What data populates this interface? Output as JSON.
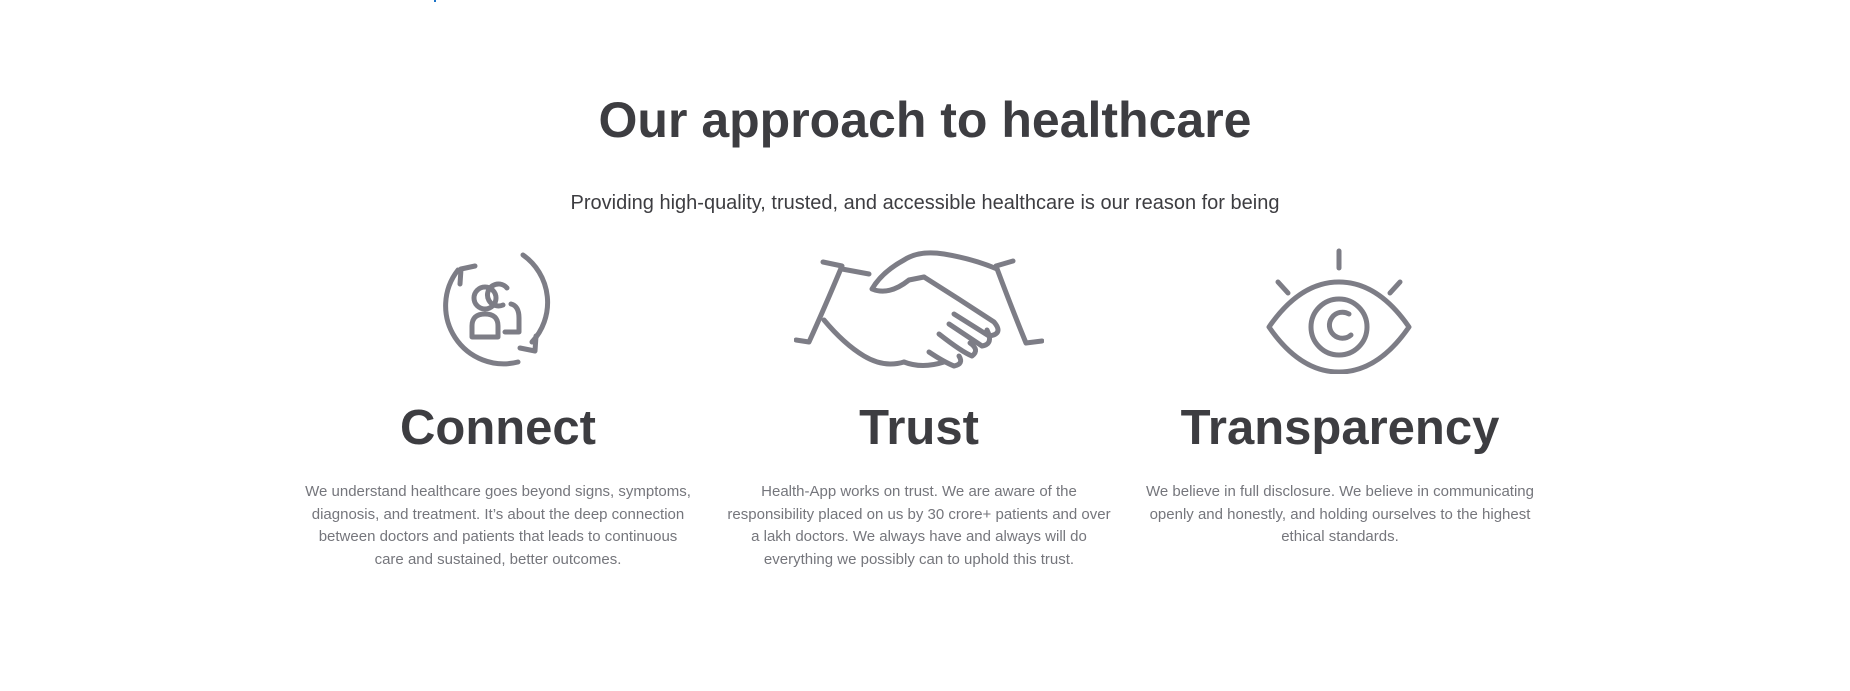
{
  "section": {
    "title": "Our approach to healthcare",
    "subtitle": "Providing high-quality, trusted, and accessible healthcare is our reason for being"
  },
  "cards": [
    {
      "icon": "connect-people-cycle-icon",
      "title": "Connect",
      "text": "We understand healthcare goes beyond signs, symptoms, diagnosis, and treatment. It’s about the deep connection between doctors and patients that leads to continuous care and sustained, better outcomes."
    },
    {
      "icon": "handshake-icon",
      "title": "Trust",
      "text": "Health-App works on trust. We are aware of the responsibility placed on us by 30 crore+ patients and over a lakh doctors. We always have and always will do everything we possibly can to uphold this trust."
    },
    {
      "icon": "eye-icon",
      "title": "Transparency",
      "text": "We believe in full disclosure. We believe in communicating openly and honestly, and holding ourselves to the highest ethical standards."
    }
  ],
  "colors": {
    "heading": "#3d3d41",
    "body_text": "#75767c",
    "icon_stroke": "#7d7d86",
    "accent": "#1a73c8",
    "background": "#ffffff"
  }
}
